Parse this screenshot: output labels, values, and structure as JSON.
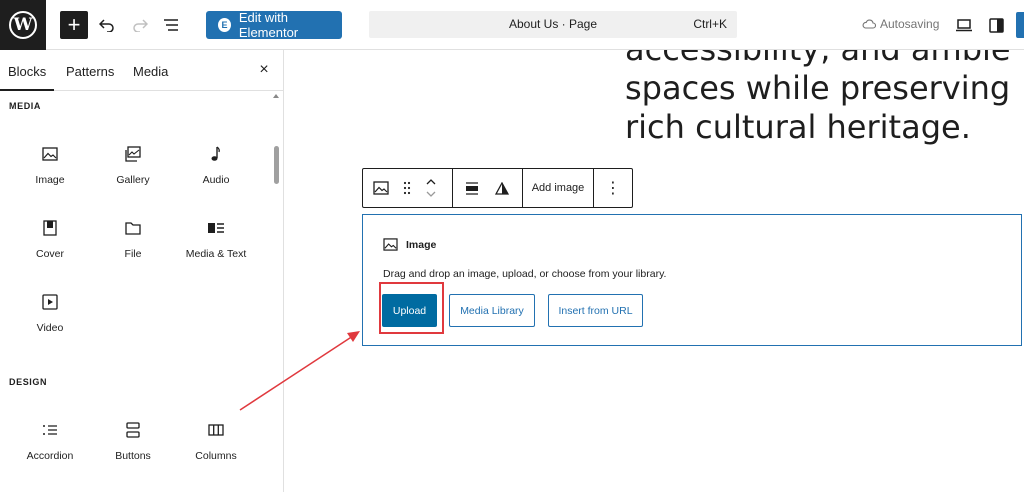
{
  "topbar": {
    "logo_letter": "W",
    "add_icon": "plus-icon",
    "undo_icon": "undo-icon",
    "redo_icon": "redo-icon",
    "document_overview_icon": "list-view-icon",
    "elementor_label": "Edit with Elementor",
    "elementor_icon_letter": "E",
    "command": {
      "title": "About Us · Page",
      "shortcut": "Ctrl+K"
    },
    "autosave_label": "Autosaving",
    "view_icon": "desktop-icon",
    "settings_icon": "sidebar-icon",
    "accent_color": "#2271b1"
  },
  "sidebar": {
    "tabs": [
      {
        "label": "Blocks",
        "active": true
      },
      {
        "label": "Patterns",
        "active": false
      },
      {
        "label": "Media",
        "active": false
      }
    ],
    "close_label": "×",
    "sections": [
      {
        "title": "MEDIA",
        "blocks": [
          {
            "label": "Image",
            "icon": "image-icon"
          },
          {
            "label": "Gallery",
            "icon": "gallery-icon"
          },
          {
            "label": "Audio",
            "icon": "audio-icon"
          },
          {
            "label": "Cover",
            "icon": "cover-icon"
          },
          {
            "label": "File",
            "icon": "file-icon"
          },
          {
            "label": "Media & Text",
            "icon": "media-text-icon"
          },
          {
            "label": "Video",
            "icon": "video-icon"
          }
        ]
      },
      {
        "title": "DESIGN",
        "blocks": [
          {
            "label": "Accordion",
            "icon": "accordion-icon"
          },
          {
            "label": "Buttons",
            "icon": "buttons-icon"
          },
          {
            "label": "Columns",
            "icon": "columns-icon"
          }
        ]
      }
    ]
  },
  "canvas": {
    "paragraph_lines": [
      "accessibility, and ambie",
      "spaces while preserving ",
      "rich cultural heritage."
    ],
    "block_toolbar": {
      "add_image_label": "Add image",
      "more_label": "⋮"
    },
    "image_block": {
      "title": "Image",
      "description": "Drag and drop an image, upload, or choose from your library.",
      "upload_label": "Upload",
      "media_library_label": "Media Library",
      "insert_url_label": "Insert from URL",
      "upload_color": "#006ba1"
    },
    "annotation_color": "#e0393e"
  }
}
